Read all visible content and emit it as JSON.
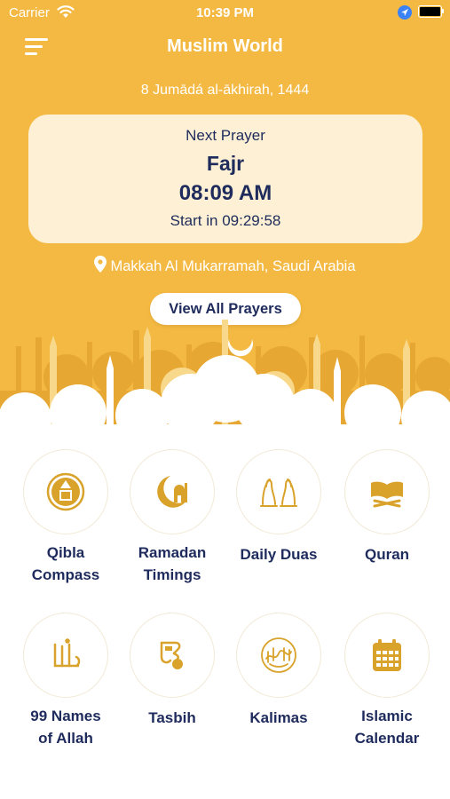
{
  "status_bar": {
    "carrier": "Carrier",
    "time": "10:39 PM"
  },
  "header": {
    "title": "Muslim World",
    "hijri_date": "8 Jumādá al-ākhirah, 1444"
  },
  "next_prayer": {
    "label": "Next Prayer",
    "name": "Fajr",
    "time": "08:09 AM",
    "countdown": "Start in 09:29:58"
  },
  "location": "Makkah Al Mukarramah, Saudi Arabia",
  "view_all_button": "View All Prayers",
  "features": [
    {
      "line1": "Qibla",
      "line2": "Compass",
      "icon": "qibla-compass-icon"
    },
    {
      "line1": "Ramadan",
      "line2": "Timings",
      "icon": "crescent-mosque-icon"
    },
    {
      "line1": "Daily Duas",
      "line2": "",
      "icon": "praying-hands-icon"
    },
    {
      "line1": "Quran",
      "line2": "",
      "icon": "quran-book-icon"
    },
    {
      "line1": "99 Names",
      "line2": "of Allah",
      "icon": "allah-calligraphy-icon"
    },
    {
      "line1": "Tasbih",
      "line2": "",
      "icon": "tasbih-counter-icon"
    },
    {
      "line1": "Kalimas",
      "line2": "",
      "icon": "kalima-calligraphy-icon"
    },
    {
      "line1": "Islamic",
      "line2": "Calendar",
      "icon": "calendar-icon"
    }
  ],
  "colors": {
    "accent": "#f4b942",
    "icon_gold": "#d9a22a",
    "text_navy": "#1e2b5c",
    "card_bg": "#fdf0d4"
  }
}
